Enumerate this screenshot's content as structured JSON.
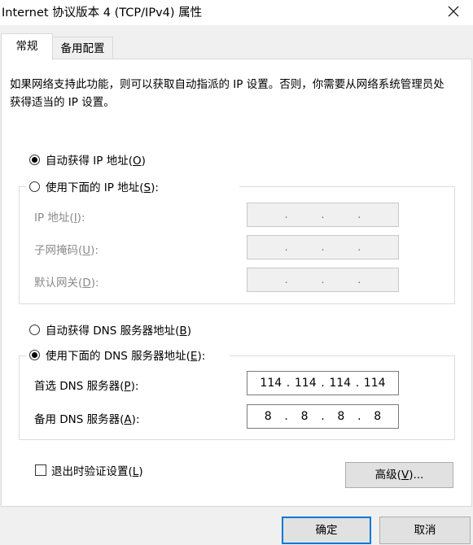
{
  "window": {
    "title": "Internet 协议版本 4 (TCP/IPv4) 属性",
    "close_icon": "close-icon"
  },
  "tabs": [
    {
      "label": "常规",
      "active": true
    },
    {
      "label": "备用配置",
      "active": false
    }
  ],
  "description": "如果网络支持此功能，则可以获取自动指派的 IP 设置。否则，你需要从网络系统管理员处获得适当的 IP 设置。",
  "ip_section": {
    "auto_label": "自动获得 IP 地址(",
    "auto_key": "O",
    "auto_suffix": ")",
    "auto_selected": true,
    "manual_label": "使用下面的 IP 地址(",
    "manual_key": "S",
    "manual_suffix": "):",
    "manual_selected": false,
    "fields": [
      {
        "label": "IP 地址(",
        "key": "I",
        "suffix": "):",
        "octets": [
          "",
          "",
          "",
          ""
        ]
      },
      {
        "label": "子网掩码(",
        "key": "U",
        "suffix": "):",
        "octets": [
          "",
          "",
          "",
          ""
        ]
      },
      {
        "label": "默认网关(",
        "key": "D",
        "suffix": "):",
        "octets": [
          "",
          "",
          "",
          ""
        ]
      }
    ]
  },
  "dns_section": {
    "auto_label": "自动获得 DNS 服务器地址(",
    "auto_key": "B",
    "auto_suffix": ")",
    "auto_selected": false,
    "manual_label": "使用下面的 DNS 服务器地址(",
    "manual_key": "E",
    "manual_suffix": "):",
    "manual_selected": true,
    "fields": [
      {
        "label": "首选 DNS 服务器(",
        "key": "P",
        "suffix": "):",
        "octets": [
          "114",
          "114",
          "114",
          "114"
        ]
      },
      {
        "label": "备用 DNS 服务器(",
        "key": "A",
        "suffix": "):",
        "octets": [
          "8",
          "8",
          "8",
          "8"
        ]
      }
    ]
  },
  "validate": {
    "label": "退出时验证设置(",
    "key": "L",
    "suffix": ")",
    "checked": false
  },
  "buttons": {
    "advanced_label": "高级(",
    "advanced_key": "V",
    "advanced_suffix": ")...",
    "ok": "确定",
    "cancel": "取消"
  },
  "colors": {
    "accent": "#0078d7",
    "panel": "#ffffff",
    "background": "#f0f0f0"
  }
}
